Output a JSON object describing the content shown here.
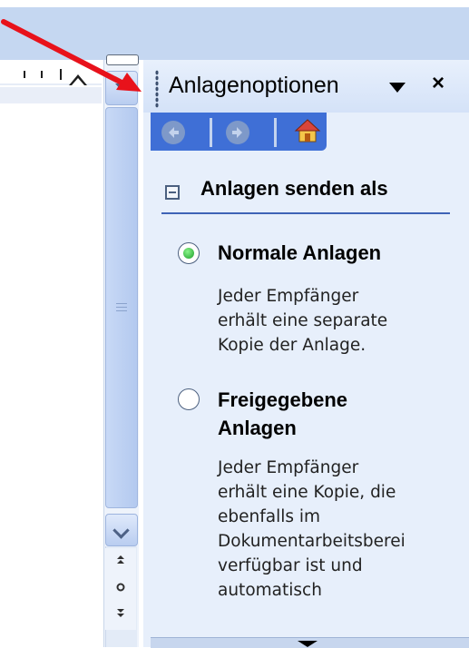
{
  "taskpane": {
    "title": "Anlagenoptionen",
    "close_label": "×",
    "section_title": "Anlagen senden als",
    "options": [
      {
        "label": "Normale Anlagen",
        "selected": true,
        "description": [
          "Jeder Empfänger",
          "erhält eine separate",
          "Kopie der Anlage."
        ]
      },
      {
        "label": "Freigegebene Anlagen",
        "label_lines": [
          "Freigegebene",
          "Anlagen"
        ],
        "selected": false,
        "description": [
          "Jeder Empfänger",
          "erhält eine Kopie, die",
          "ebenfalls im",
          "Dokumentarbeitsberei",
          "verfügbar ist und",
          "automatisch"
        ]
      }
    ]
  },
  "navigation": {
    "back_icon": "back-arrow-icon",
    "forward_icon": "forward-arrow-icon",
    "home_icon": "home-icon"
  },
  "colors": {
    "pane_background": "#e7effb",
    "nav_bar": "#3f6fd6",
    "section_rule": "#3f63b6",
    "annotation_arrow": "#e8121b",
    "radio_selected": "#1c9d2a"
  }
}
